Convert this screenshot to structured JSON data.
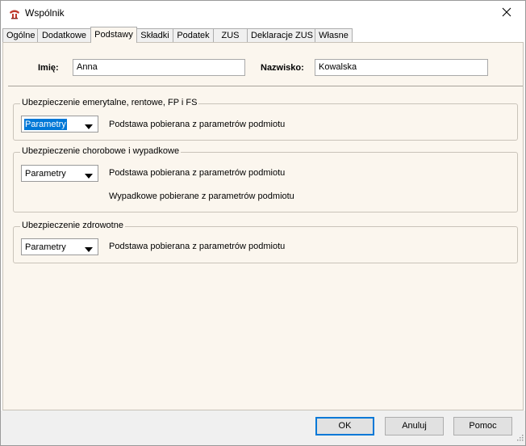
{
  "window": {
    "title": "Wspólnik",
    "app_icon": "app-logo-icon",
    "close_icon": "close-icon"
  },
  "tabs": [
    {
      "label": "Ogólne",
      "active": false
    },
    {
      "label": "Dodatkowe",
      "active": false
    },
    {
      "label": "Podstawy",
      "active": true
    },
    {
      "label": "Składki",
      "active": false
    },
    {
      "label": "Podatek",
      "active": false
    },
    {
      "label": "ZUS",
      "active": false
    },
    {
      "label": "Deklaracje ZUS",
      "active": false
    },
    {
      "label": "Własne",
      "active": false
    }
  ],
  "person": {
    "first_name_label": "Imię:",
    "first_name_value": "Anna",
    "last_name_label": "Nazwisko:",
    "last_name_value": "Kowalska"
  },
  "groups": {
    "pension": {
      "title": "Ubezpieczenie emerytalne, rentowe, FP i FS",
      "combo_value": "Parametry",
      "combo_selected": true,
      "base_text": "Podstawa pobierana z parametrów podmiotu"
    },
    "sickness": {
      "title": "Ubezpieczenie chorobowe i wypadkowe",
      "combo_value": "Parametry",
      "base_text": "Podstawa pobierana z parametrów podmiotu",
      "accident_text": "Wypadkowe pobierane z parametrów podmiotu"
    },
    "health": {
      "title": "Ubezpieczenie zdrowotne",
      "combo_value": "Parametry",
      "base_text": "Podstawa pobierana z parametrów podmiotu"
    }
  },
  "buttons": {
    "ok": "OK",
    "cancel": "Anuluj",
    "help": "Pomoc"
  },
  "colors": {
    "panel_bg": "#fbf6ee",
    "selection": "#0078d7",
    "app_icon": "#c0392b"
  }
}
